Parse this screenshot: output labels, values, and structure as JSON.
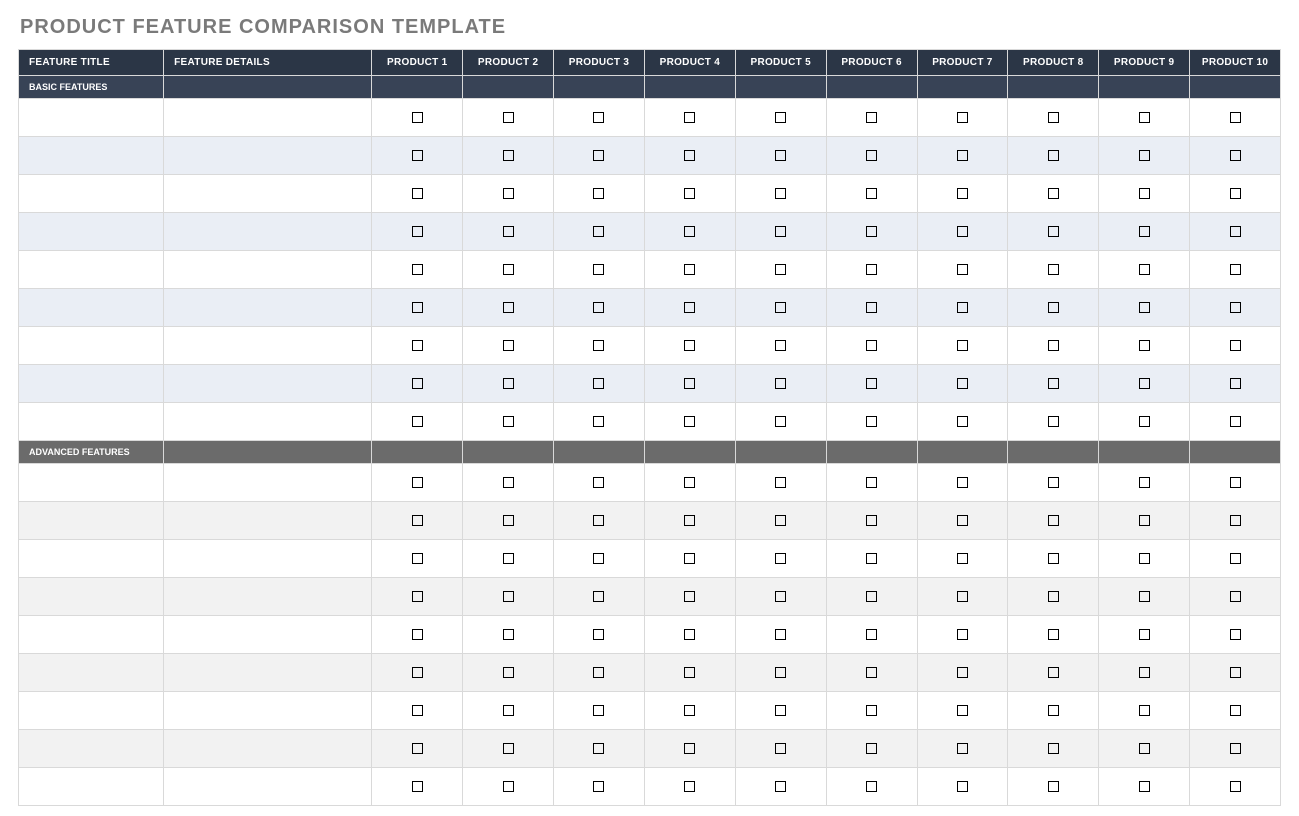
{
  "title": "PRODUCT FEATURE COMPARISON TEMPLATE",
  "headers": {
    "feature_title": "FEATURE TITLE",
    "feature_details": "FEATURE DETAILS",
    "products": [
      "PRODUCT 1",
      "PRODUCT 2",
      "PRODUCT 3",
      "PRODUCT 4",
      "PRODUCT 5",
      "PRODUCT 6",
      "PRODUCT 7",
      "PRODUCT 8",
      "PRODUCT 9",
      "PRODUCT 10"
    ]
  },
  "sections": [
    {
      "name": "BASIC FEATURES",
      "style": "basic",
      "rows": [
        {
          "title": "",
          "details": "",
          "checks": [
            false,
            false,
            false,
            false,
            false,
            false,
            false,
            false,
            false,
            false
          ]
        },
        {
          "title": "",
          "details": "",
          "checks": [
            false,
            false,
            false,
            false,
            false,
            false,
            false,
            false,
            false,
            false
          ]
        },
        {
          "title": "",
          "details": "",
          "checks": [
            false,
            false,
            false,
            false,
            false,
            false,
            false,
            false,
            false,
            false
          ]
        },
        {
          "title": "",
          "details": "",
          "checks": [
            false,
            false,
            false,
            false,
            false,
            false,
            false,
            false,
            false,
            false
          ]
        },
        {
          "title": "",
          "details": "",
          "checks": [
            false,
            false,
            false,
            false,
            false,
            false,
            false,
            false,
            false,
            false
          ]
        },
        {
          "title": "",
          "details": "",
          "checks": [
            false,
            false,
            false,
            false,
            false,
            false,
            false,
            false,
            false,
            false
          ]
        },
        {
          "title": "",
          "details": "",
          "checks": [
            false,
            false,
            false,
            false,
            false,
            false,
            false,
            false,
            false,
            false
          ]
        },
        {
          "title": "",
          "details": "",
          "checks": [
            false,
            false,
            false,
            false,
            false,
            false,
            false,
            false,
            false,
            false
          ]
        },
        {
          "title": "",
          "details": "",
          "checks": [
            false,
            false,
            false,
            false,
            false,
            false,
            false,
            false,
            false,
            false
          ]
        }
      ]
    },
    {
      "name": "ADVANCED FEATURES",
      "style": "advanced",
      "rows": [
        {
          "title": "",
          "details": "",
          "checks": [
            false,
            false,
            false,
            false,
            false,
            false,
            false,
            false,
            false,
            false
          ]
        },
        {
          "title": "",
          "details": "",
          "checks": [
            false,
            false,
            false,
            false,
            false,
            false,
            false,
            false,
            false,
            false
          ]
        },
        {
          "title": "",
          "details": "",
          "checks": [
            false,
            false,
            false,
            false,
            false,
            false,
            false,
            false,
            false,
            false
          ]
        },
        {
          "title": "",
          "details": "",
          "checks": [
            false,
            false,
            false,
            false,
            false,
            false,
            false,
            false,
            false,
            false
          ]
        },
        {
          "title": "",
          "details": "",
          "checks": [
            false,
            false,
            false,
            false,
            false,
            false,
            false,
            false,
            false,
            false
          ]
        },
        {
          "title": "",
          "details": "",
          "checks": [
            false,
            false,
            false,
            false,
            false,
            false,
            false,
            false,
            false,
            false
          ]
        },
        {
          "title": "",
          "details": "",
          "checks": [
            false,
            false,
            false,
            false,
            false,
            false,
            false,
            false,
            false,
            false
          ]
        },
        {
          "title": "",
          "details": "",
          "checks": [
            false,
            false,
            false,
            false,
            false,
            false,
            false,
            false,
            false,
            false
          ]
        },
        {
          "title": "",
          "details": "",
          "checks": [
            false,
            false,
            false,
            false,
            false,
            false,
            false,
            false,
            false,
            false
          ]
        }
      ]
    }
  ]
}
